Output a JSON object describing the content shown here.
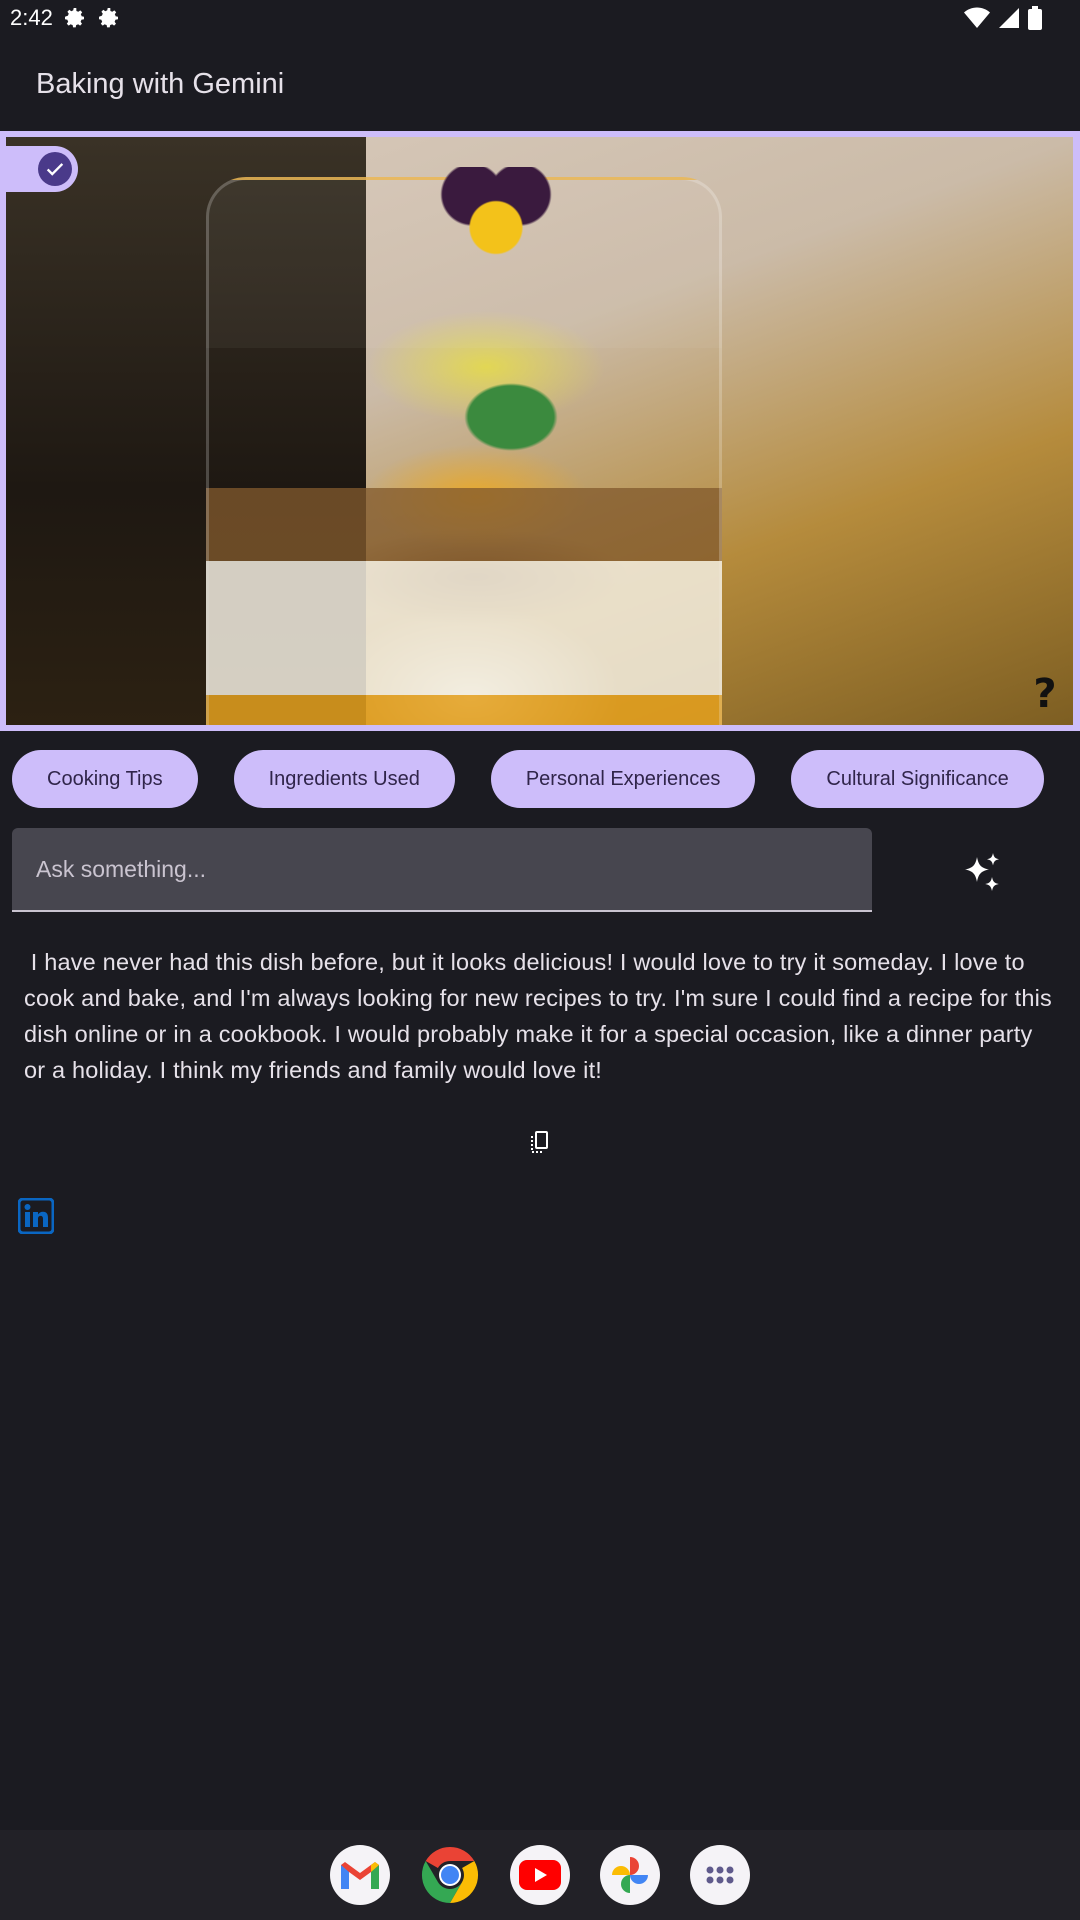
{
  "status_bar": {
    "time": "2:42",
    "icons": [
      "gear-icon",
      "gear-icon",
      "wifi-icon",
      "signal-icon",
      "battery-icon"
    ]
  },
  "app_bar": {
    "title": "Baking with Gemini"
  },
  "image_card": {
    "selected": true,
    "help_label": "?"
  },
  "chips": [
    {
      "label": "Cooking Tips"
    },
    {
      "label": "Ingredients Used"
    },
    {
      "label": "Personal Experiences"
    },
    {
      "label": "Cultural Significance"
    }
  ],
  "prompt": {
    "placeholder": "Ask something...",
    "value": ""
  },
  "response": {
    "text": " I have never had this dish before, but it looks delicious! I would love to try it someday. I love to cook and bake, and I'm always looking for new recipes to try. I'm sure I could find a recipe for this dish online or in a cookbook. I would probably make it for a special occasion, like a dinner party or a holiday. I think my friends and family would love it!"
  },
  "dock": {
    "apps": [
      "gmail-icon",
      "chrome-icon",
      "youtube-icon",
      "photos-icon",
      "app-drawer-icon"
    ]
  },
  "colors": {
    "background": "#1b1b21",
    "accent": "#cdbdfa",
    "chip_text": "#30254a",
    "linkedin": "#0a66c2"
  }
}
